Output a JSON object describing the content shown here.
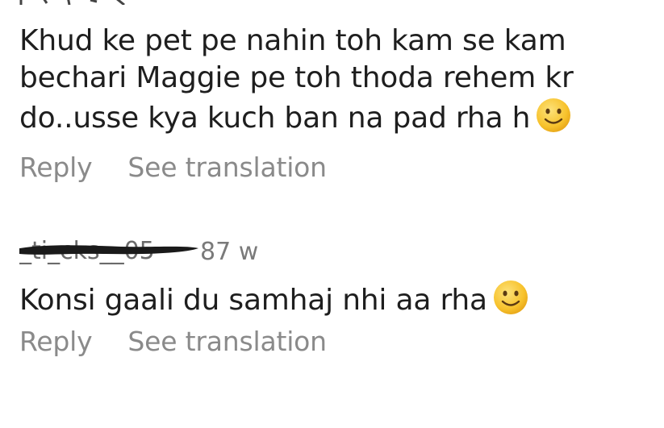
{
  "comments": [
    {
      "text": "Khud ke pet pe nahin toh kam se kam bechari Maggie pe toh thoda rehem kr do..usse kya kuch ban na pad rha h",
      "emoji": "slightly-smiling-face-icon",
      "reply_label": "Reply",
      "translate_label": "See translation"
    },
    {
      "username": "_ti_cks__05",
      "time": "87 w",
      "text": "Konsi gaali du samhaj nhi aa rha",
      "emoji": "slightly-smiling-face-icon",
      "reply_label": "Reply",
      "translate_label": "See translation"
    }
  ],
  "colors": {
    "text": "#1e1e1e",
    "secondary": "#8a8a8a",
    "emoji_face": "#f7c22c",
    "redaction": "#1a1a1a"
  }
}
